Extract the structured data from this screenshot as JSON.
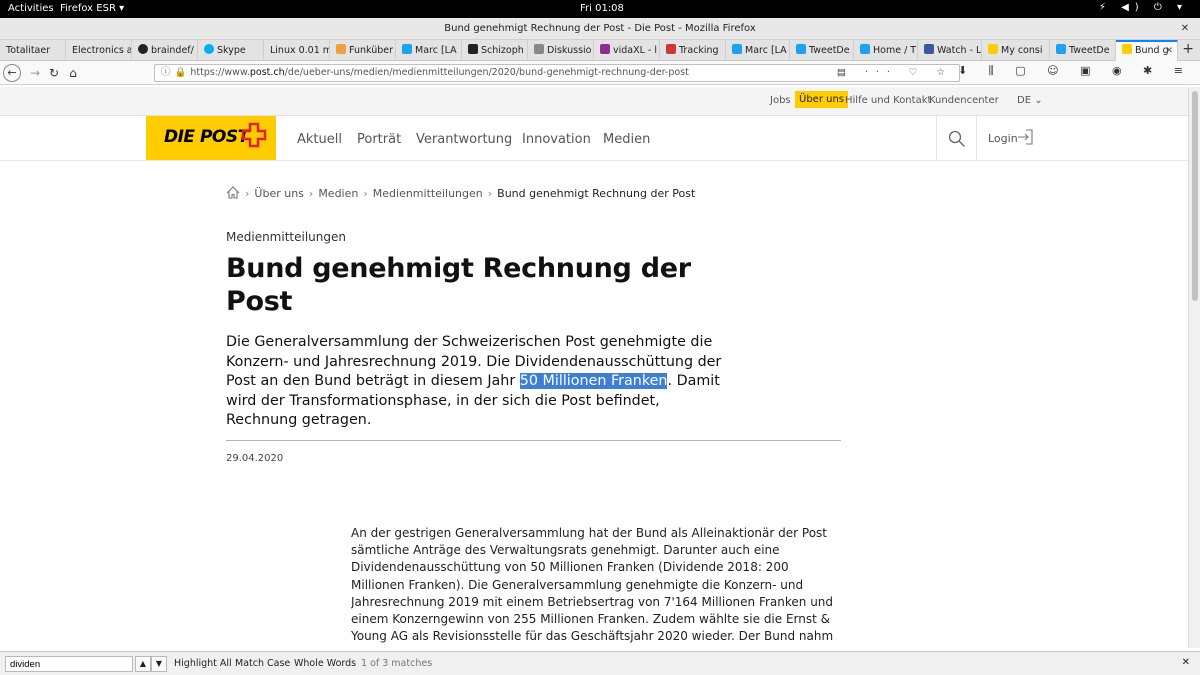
{
  "system": {
    "activities": "Activities",
    "app_name": "Firefox ESR ▾",
    "clock": "Fri 01:08",
    "tray": "⚡ ◀) ⏻ ▾"
  },
  "window": {
    "title": "Bund genehmigt Rechnung der Post - Die Post - Mozilla Firefox",
    "close": "✕"
  },
  "tabs": [
    {
      "label": "Totalitaer",
      "color": ""
    },
    {
      "label": "Electronics a",
      "color": ""
    },
    {
      "label": "braindef/",
      "color": "#222222"
    },
    {
      "label": "Skype",
      "color": "#00aff0"
    },
    {
      "label": "Linux 0.01 m",
      "color": ""
    },
    {
      "label": "Funküber",
      "color": "#f0a040"
    },
    {
      "label": "Marc [LA",
      "color": "#1da1f2"
    },
    {
      "label": "Schizoph",
      "color": "#222222"
    },
    {
      "label": "Diskussio",
      "color": "#888888"
    },
    {
      "label": "vidaXL - l",
      "color": "#8e2d8e"
    },
    {
      "label": "Tracking",
      "color": "#d2353a"
    },
    {
      "label": "Marc [LA",
      "color": "#1da1f2"
    },
    {
      "label": "TweetDe",
      "color": "#1da1f2"
    },
    {
      "label": "Home / T",
      "color": "#1da1f2"
    },
    {
      "label": "Watch - L",
      "color": "#3b5998"
    },
    {
      "label": "My consi",
      "color": "#ffcc00"
    },
    {
      "label": "TweetDe",
      "color": "#1da1f2"
    },
    {
      "label": "Bund g",
      "color": "#ffcc00"
    }
  ],
  "newtab": "+",
  "nav": {
    "back": "←",
    "forward": "→",
    "reload": "↻",
    "home": "⌂",
    "url_prefix": "https://www.",
    "url_domain": "post.ch",
    "url_path": "/de/ueber-uns/medien/medienmitteilungen/2020/bund-genehmigt-rechnung-der-post",
    "url_actions": "▤ ··· ♡ ☆",
    "tools": "⬇ ⫼ ▢ ☺ ▣ ◉ ✱ ≡"
  },
  "site": {
    "util_links": [
      "Jobs",
      "Über uns",
      "Hilfe und Kontakt",
      "Kundencenter"
    ],
    "language": "DE ⌄",
    "logo_text": "DIE POST",
    "main_nav": [
      "Aktuell",
      "Porträt",
      "Verantwortung",
      "Innovation",
      "Medien"
    ],
    "login": "Login",
    "brand_color": "#ffcc00",
    "accent_red": "#e2211c"
  },
  "breadcrumb": [
    "Über uns",
    "Medien",
    "Medienmitteilungen",
    "Bund genehmigt Rechnung der Post"
  ],
  "article": {
    "kicker": "Medienmitteilungen",
    "title": "Bund genehmigt Rechnung der Post",
    "lead_before": "Die Generalversammlung der Schweizerischen Post genehmigte die Konzern- und Jahresrechnung 2019. Die Dividendenausschüttung der Post an den Bund beträgt in diesem Jahr ",
    "lead_highlight": "50 Millionen Franken",
    "lead_after": ". Damit wird der Transformationsphase, in der sich die Post befindet, Rechnung getragen.",
    "date": "29.04.2020",
    "body": "An der gestrigen Generalversammlung hat der Bund als Alleinaktionär der Post sämtliche Anträge des Verwaltungsrats genehmigt. Darunter auch eine Dividendenausschüttung von 50 Millionen Franken (Dividende 2018: 200 Millionen Franken). Die Generalversammlung genehmigte die Konzern- und Jahresrechnung 2019 mit einem Betriebsertrag von 7'164 Millionen Franken und einem Konzerngewinn von 255 Millionen Franken. Zudem wählte sie die Ernst & Young AG als Revisionsstelle für das Geschäftsjahr 2020 wieder. Der Bund nahm zur Kenntnis, dass"
  },
  "findbar": {
    "query": "dividen",
    "up": "▲",
    "down": "▼",
    "highlight_all": "Highlight All",
    "match_case": "Match Case",
    "whole_words": "Whole Words",
    "count": "1 of 3 matches",
    "close": "✕"
  }
}
